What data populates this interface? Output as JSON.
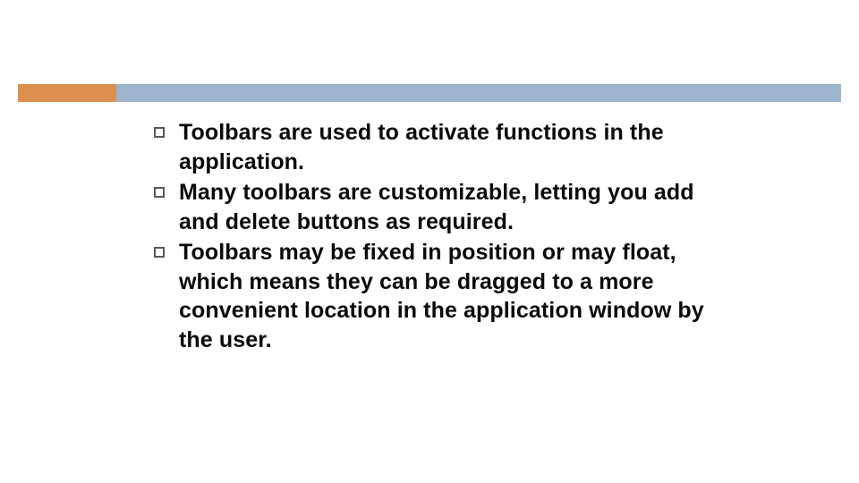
{
  "bullets": [
    {
      "text": "Toolbars are used to activate functions in the application."
    },
    {
      "text": " Many toolbars are customizable, letting you add and delete buttons as required."
    },
    {
      "text": "Toolbars may be fixed in position or may float, which means they can be dragged to a more convenient location in the application window by the user."
    }
  ]
}
